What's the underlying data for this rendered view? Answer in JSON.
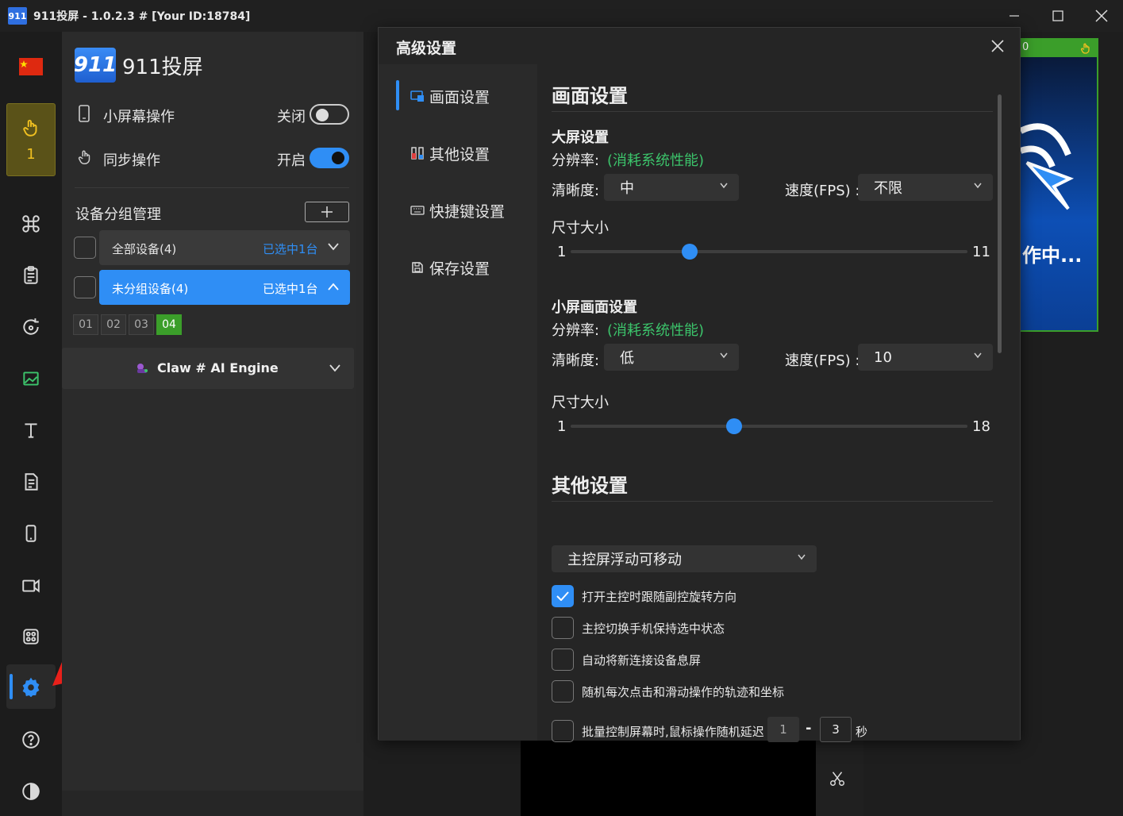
{
  "window": {
    "title": "911投屏 - 1.0.2.3 # [Your ID:18784]",
    "logo_text": "911"
  },
  "rail": {
    "active_device_count": "1",
    "items": [
      "flag-cn-icon",
      "touch-icon",
      "command-icon",
      "clipboard-icon",
      "rotate-icon",
      "image-icon",
      "text-icon",
      "document-icon",
      "phone-icon",
      "video-icon",
      "apps-icon",
      "settings-icon",
      "help-icon",
      "contrast-icon"
    ]
  },
  "panel": {
    "brand": "911投屏",
    "brand_logo": "911",
    "small_screen_label": "小屏幕操作",
    "small_screen_state": "关闭",
    "sync_label": "同步操作",
    "sync_state": "开启",
    "group_title": "设备分组管理",
    "groups": [
      {
        "name": "全部设备(4)",
        "selected": "已选中1台"
      },
      {
        "name": "未分组设备(4)",
        "selected": "已选中1台"
      }
    ],
    "devices": [
      "01",
      "02",
      "03",
      "04"
    ],
    "active_device": "04",
    "claw_label": "Claw # AI Engine"
  },
  "background": {
    "device_status": "作中...",
    "device_top_label": "0"
  },
  "dialog": {
    "title": "高级设置",
    "nav": [
      "画面设置",
      "其他设置",
      "快捷键设置",
      "保存设置"
    ],
    "section1_title": "画面设置",
    "big": {
      "title": "大屏设置",
      "resolution_label": "分辨率:",
      "resolution_hint": "(消耗系统性能)",
      "clarity_label": "清晰度:",
      "clarity_value": "中",
      "fps_label": "速度(FPS) :",
      "fps_value": "不限",
      "size_label": "尺寸大小",
      "size_min": "1",
      "size_max": "11",
      "size_value": 4
    },
    "small": {
      "title": "小屏画面设置",
      "resolution_label": "分辨率:",
      "resolution_hint": "(消耗系统性能)",
      "clarity_label": "清晰度:",
      "clarity_value": "低",
      "fps_label": "速度(FPS) :",
      "fps_value": "10",
      "size_label": "尺寸大小",
      "size_min": "1",
      "size_max": "18",
      "size_value": 8
    },
    "section2_title": "其他设置",
    "float_select": "主控屏浮动可移动",
    "options": [
      {
        "label": "打开主控时跟随副控旋转方向",
        "checked": true
      },
      {
        "label": "主控切换手机保持选中状态",
        "checked": false
      },
      {
        "label": "自动将新连接设备息屏",
        "checked": false
      },
      {
        "label": "随机每次点击和滑动操作的轨迹和坐标",
        "checked": false
      }
    ],
    "delay_label": "批量控制屏幕时,鼠标操作随机延迟",
    "delay_min": "1",
    "delay_dash": "-",
    "delay_max": "3",
    "delay_unit": "秒"
  },
  "colors": {
    "accent": "#2f8ef5",
    "hint_green": "#3cc46b",
    "device_active_green": "#3b9e2a",
    "rail_active_bg": "#5a5218"
  }
}
